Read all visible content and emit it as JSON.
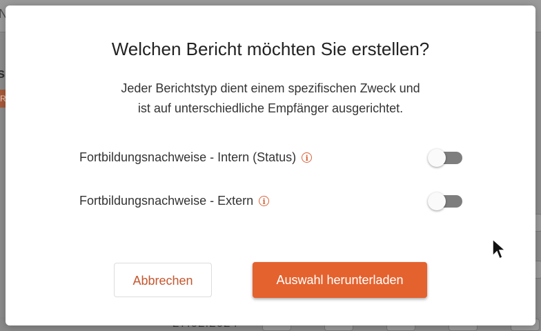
{
  "dialog": {
    "title": "Welchen Bericht möchten Sie erstellen?",
    "subtitle_line1": "Jeder Berichtstyp dient einem spezifischen Zweck und",
    "subtitle_line2": "ist auf unterschiedliche Empfänger ausgerichtet.",
    "options": [
      {
        "label": "Fortbildungsnachweise - Intern (Status)",
        "icon": "info-icon",
        "toggled": false
      },
      {
        "label": "Fortbildungsnachweise - Extern",
        "icon": "info-icon",
        "toggled": false
      }
    ],
    "cancel_label": "Abbrechen",
    "download_label": "Auswahl herunterladen"
  },
  "colors": {
    "accent": "#e4622e",
    "accent_text": "#c4572f",
    "overlay": "#8c8c8c",
    "toggle_off": "#7e7e7e"
  }
}
